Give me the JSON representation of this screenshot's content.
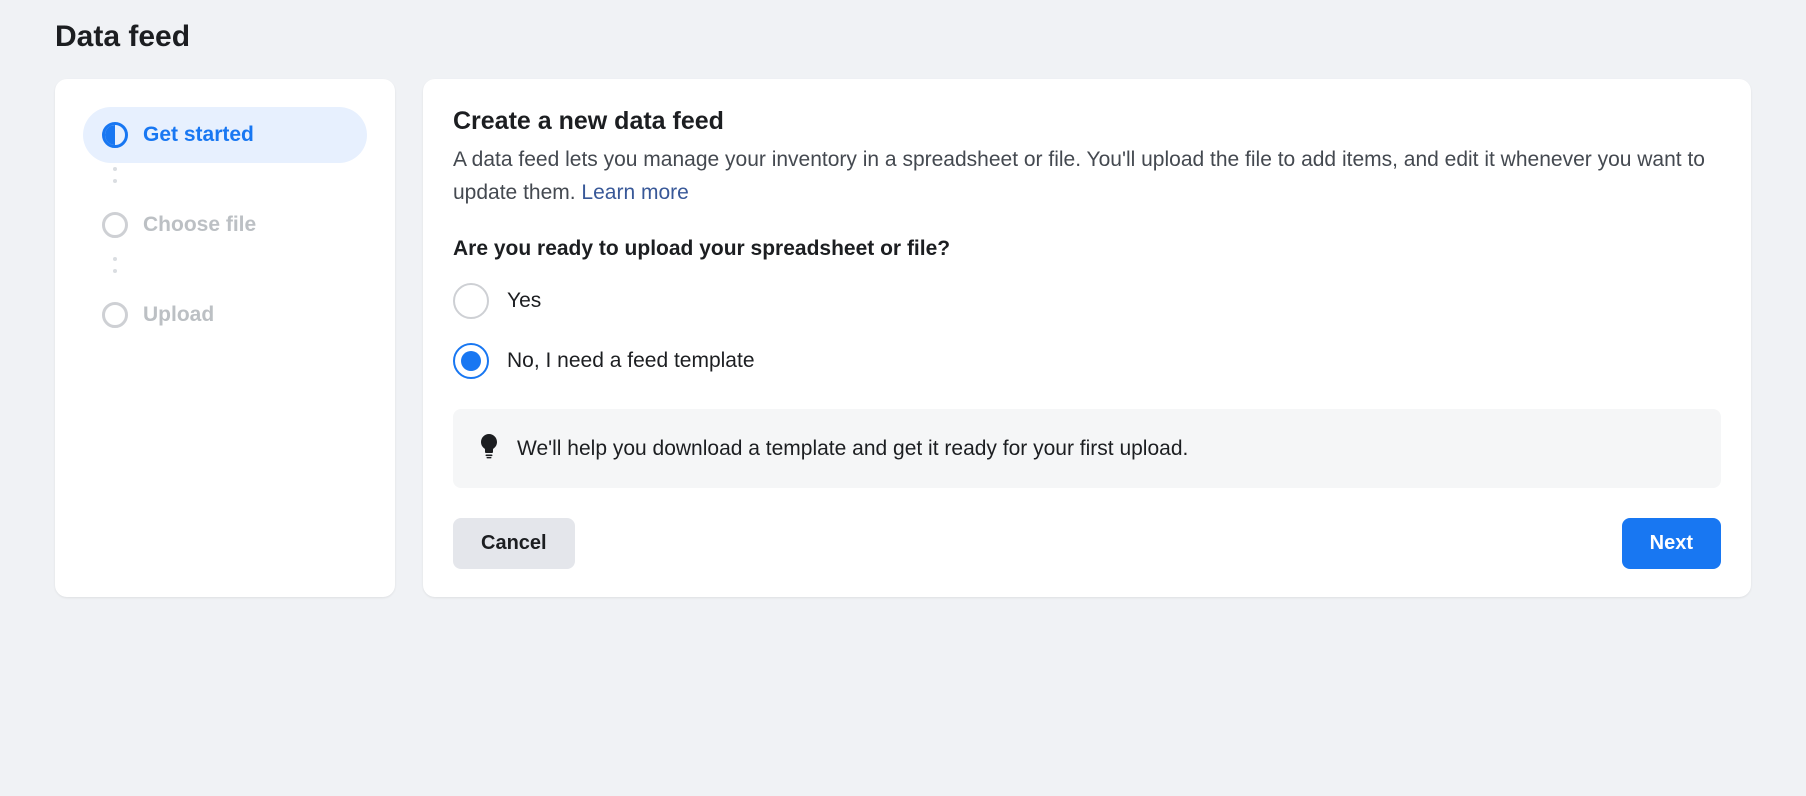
{
  "page": {
    "title": "Data feed"
  },
  "sidebar": {
    "steps": [
      {
        "label": "Get started",
        "active": true
      },
      {
        "label": "Choose file",
        "active": false
      },
      {
        "label": "Upload",
        "active": false
      }
    ]
  },
  "main": {
    "heading": "Create a new data feed",
    "description_pre": "A data feed lets you manage your inventory in a spreadsheet or file. You'll upload the file to add items, and edit it whenever you want to update them. ",
    "learn_more": "Learn more",
    "question": "Are you ready to upload your spreadsheet or file?",
    "options": {
      "yes": "Yes",
      "no": "No, I need a feed template"
    },
    "selected": "no",
    "info_text": "We'll help you download a template and get it ready for your first upload."
  },
  "actions": {
    "cancel": "Cancel",
    "next": "Next"
  }
}
